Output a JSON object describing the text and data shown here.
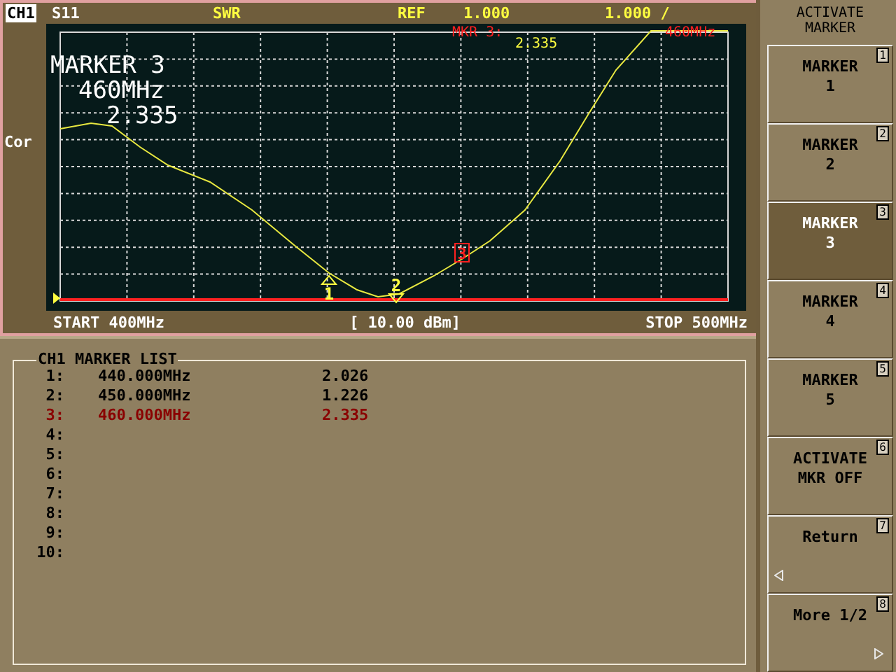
{
  "header": {
    "channel": "CH1",
    "parameter": "S11",
    "format": "SWR",
    "ref_label": "REF",
    "ref_value": "1.000",
    "scale": "1.000 /"
  },
  "side_label": "Cor",
  "marker_readout": {
    "title": "MARKER 3",
    "frequency": "460MHz",
    "value": "2.335"
  },
  "marker_annotation": {
    "label": "MKR 3:",
    "value": "2.335",
    "frequency": "460MHz"
  },
  "plot_markers": [
    {
      "label": "1",
      "active": false
    },
    {
      "label": "2",
      "active": false
    },
    {
      "label": "3",
      "active": true
    }
  ],
  "footer": {
    "start": "START 400MHz",
    "power": "[ 10.00 dBm]",
    "stop": "STOP 500MHz"
  },
  "marker_list": {
    "title": "CH1 MARKER LIST",
    "rows": [
      {
        "index": "1:",
        "frequency": "440.000MHz",
        "value": "2.026",
        "active": false
      },
      {
        "index": "2:",
        "frequency": "450.000MHz",
        "value": "1.226",
        "active": false
      },
      {
        "index": "3:",
        "frequency": "460.000MHz",
        "value": "2.335",
        "active": true
      },
      {
        "index": "4:",
        "active": false
      },
      {
        "index": "5:",
        "active": false
      },
      {
        "index": "6:",
        "active": false
      },
      {
        "index": "7:",
        "active": false
      },
      {
        "index": "8:",
        "active": false
      },
      {
        "index": "9:",
        "active": false
      },
      {
        "index": "10:",
        "active": false
      }
    ]
  },
  "softkeys": {
    "title": "ACTIVATE MARKER",
    "keys": [
      {
        "kind": "plain",
        "lines": [
          "MARKER",
          "1"
        ],
        "number": "1",
        "selected": false
      },
      {
        "kind": "plain",
        "lines": [
          "MARKER",
          "2"
        ],
        "number": "2",
        "selected": false
      },
      {
        "kind": "plain",
        "lines": [
          "MARKER",
          "3"
        ],
        "number": "3",
        "selected": true
      },
      {
        "kind": "plain",
        "lines": [
          "MARKER",
          "4"
        ],
        "number": "4",
        "selected": false
      },
      {
        "kind": "plain",
        "lines": [
          "MARKER",
          "5"
        ],
        "number": "5",
        "selected": false
      },
      {
        "kind": "plain",
        "lines": [
          "ACTIVATE",
          "MKR OFF"
        ],
        "number": "6",
        "selected": false
      },
      {
        "kind": "back",
        "lines": [
          "Return"
        ],
        "number": "7",
        "selected": false
      },
      {
        "kind": "more",
        "lines": [
          "More 1/2"
        ],
        "number": "8",
        "selected": false
      }
    ]
  }
}
